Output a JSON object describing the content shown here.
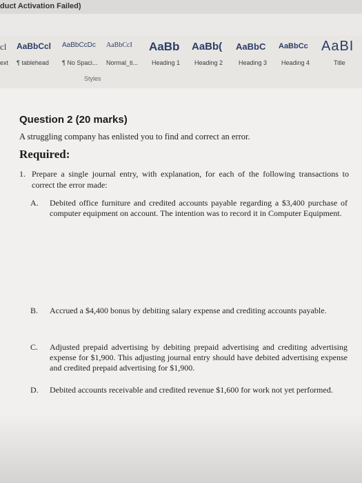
{
  "window": {
    "title": "duct Activation Failed)"
  },
  "ribbon": {
    "styles": [
      {
        "preview": "cl",
        "label": "ext"
      },
      {
        "preview": "AaBbCcl",
        "label": "¶ tablehead"
      },
      {
        "preview": "AaBbCcDc",
        "label": "¶ No Spaci..."
      },
      {
        "preview": "AaBbCcI",
        "label": "Normal_ti..."
      },
      {
        "preview": "AaBb",
        "label": "Heading 1"
      },
      {
        "preview": "AaBb(",
        "label": "Heading 2"
      },
      {
        "preview": "AaBbC",
        "label": "Heading 3"
      },
      {
        "preview": "AaBbCc",
        "label": "Heading 4"
      },
      {
        "preview": "AaBI",
        "label": "Title"
      }
    ],
    "group_label": "Styles"
  },
  "document": {
    "question_title": "Question 2 (20 marks)",
    "intro": "A struggling company has enlisted you to find and correct an error.",
    "required": "Required:",
    "item1": {
      "number": "1.",
      "text": "Prepare a single journal entry, with explanation, for each of the following transactions to correct the error made:"
    },
    "subitems": [
      {
        "letter": "A.",
        "text": "Debited office furniture and credited accounts payable regarding a $3,400 purchase of computer equipment on account. The intention was to record it in Computer Equipment."
      },
      {
        "letter": "B.",
        "text": "Accrued a $4,400 bonus by debiting salary expense and crediting accounts payable."
      },
      {
        "letter": "C.",
        "text": "Adjusted prepaid advertising by debiting prepaid advertising and crediting advertising expense for $1,900. This adjusting journal entry should have debited advertising expense and credited prepaid advertising for $1,900."
      },
      {
        "letter": "D.",
        "text": "Debited accounts receivable and credited revenue $1,600 for work not yet performed."
      }
    ]
  }
}
